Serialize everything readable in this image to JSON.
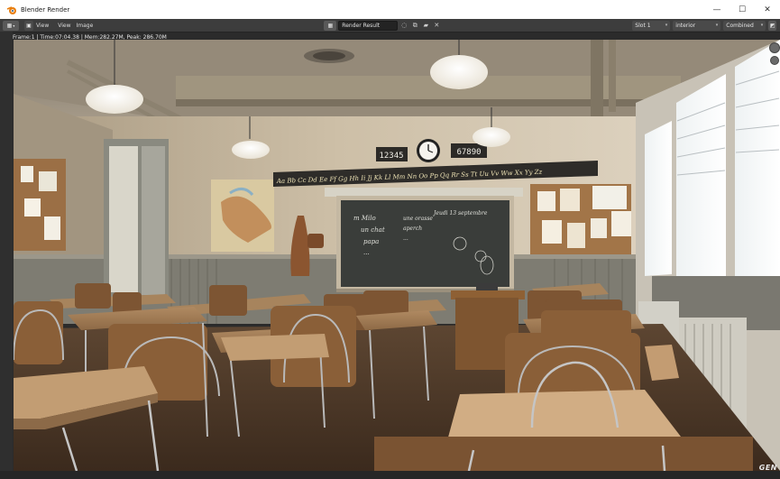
{
  "window": {
    "title": "Blender Render",
    "minimize": "—",
    "maximize": "☐",
    "close": "✕"
  },
  "header": {
    "menu": [
      "View",
      "View",
      "Image"
    ],
    "image_name": "Render Result",
    "slot": "Slot 1",
    "layer": "interior",
    "pass": "Combined"
  },
  "status": {
    "text": "Frame:1 | Time:07:04.38 | Mem:282.27M, Peak: 286.70M"
  },
  "scene": {
    "number_left": "12345",
    "number_right": "67890",
    "alphabet": "Aa Bb  Cc Dd Ee Ff Gg Hh Ii Jj Kk Ll Mm Nn Oo Pp Qq Rr Ss Tt Uu Vv Ww Xx Yy Zz",
    "board_left": [
      "m  Milo",
      "un chat",
      "papa",
      "..."
    ],
    "board_mid": [
      "une orasse",
      "aperch",
      "..."
    ],
    "board_date": "Jeudi 13 septembre"
  },
  "watermark": "GEN",
  "colors": {
    "titlebar": "#ffffff",
    "header": "#3d3d3d",
    "background": "#2b2b2b",
    "chalkboard": "#3a3d3a",
    "wood": "#8a6035",
    "wall": "#cdbfa7"
  },
  "icons": {
    "app": "blender-icon",
    "editor_type": "image-editor-icon",
    "view_mode": "view-icon"
  }
}
